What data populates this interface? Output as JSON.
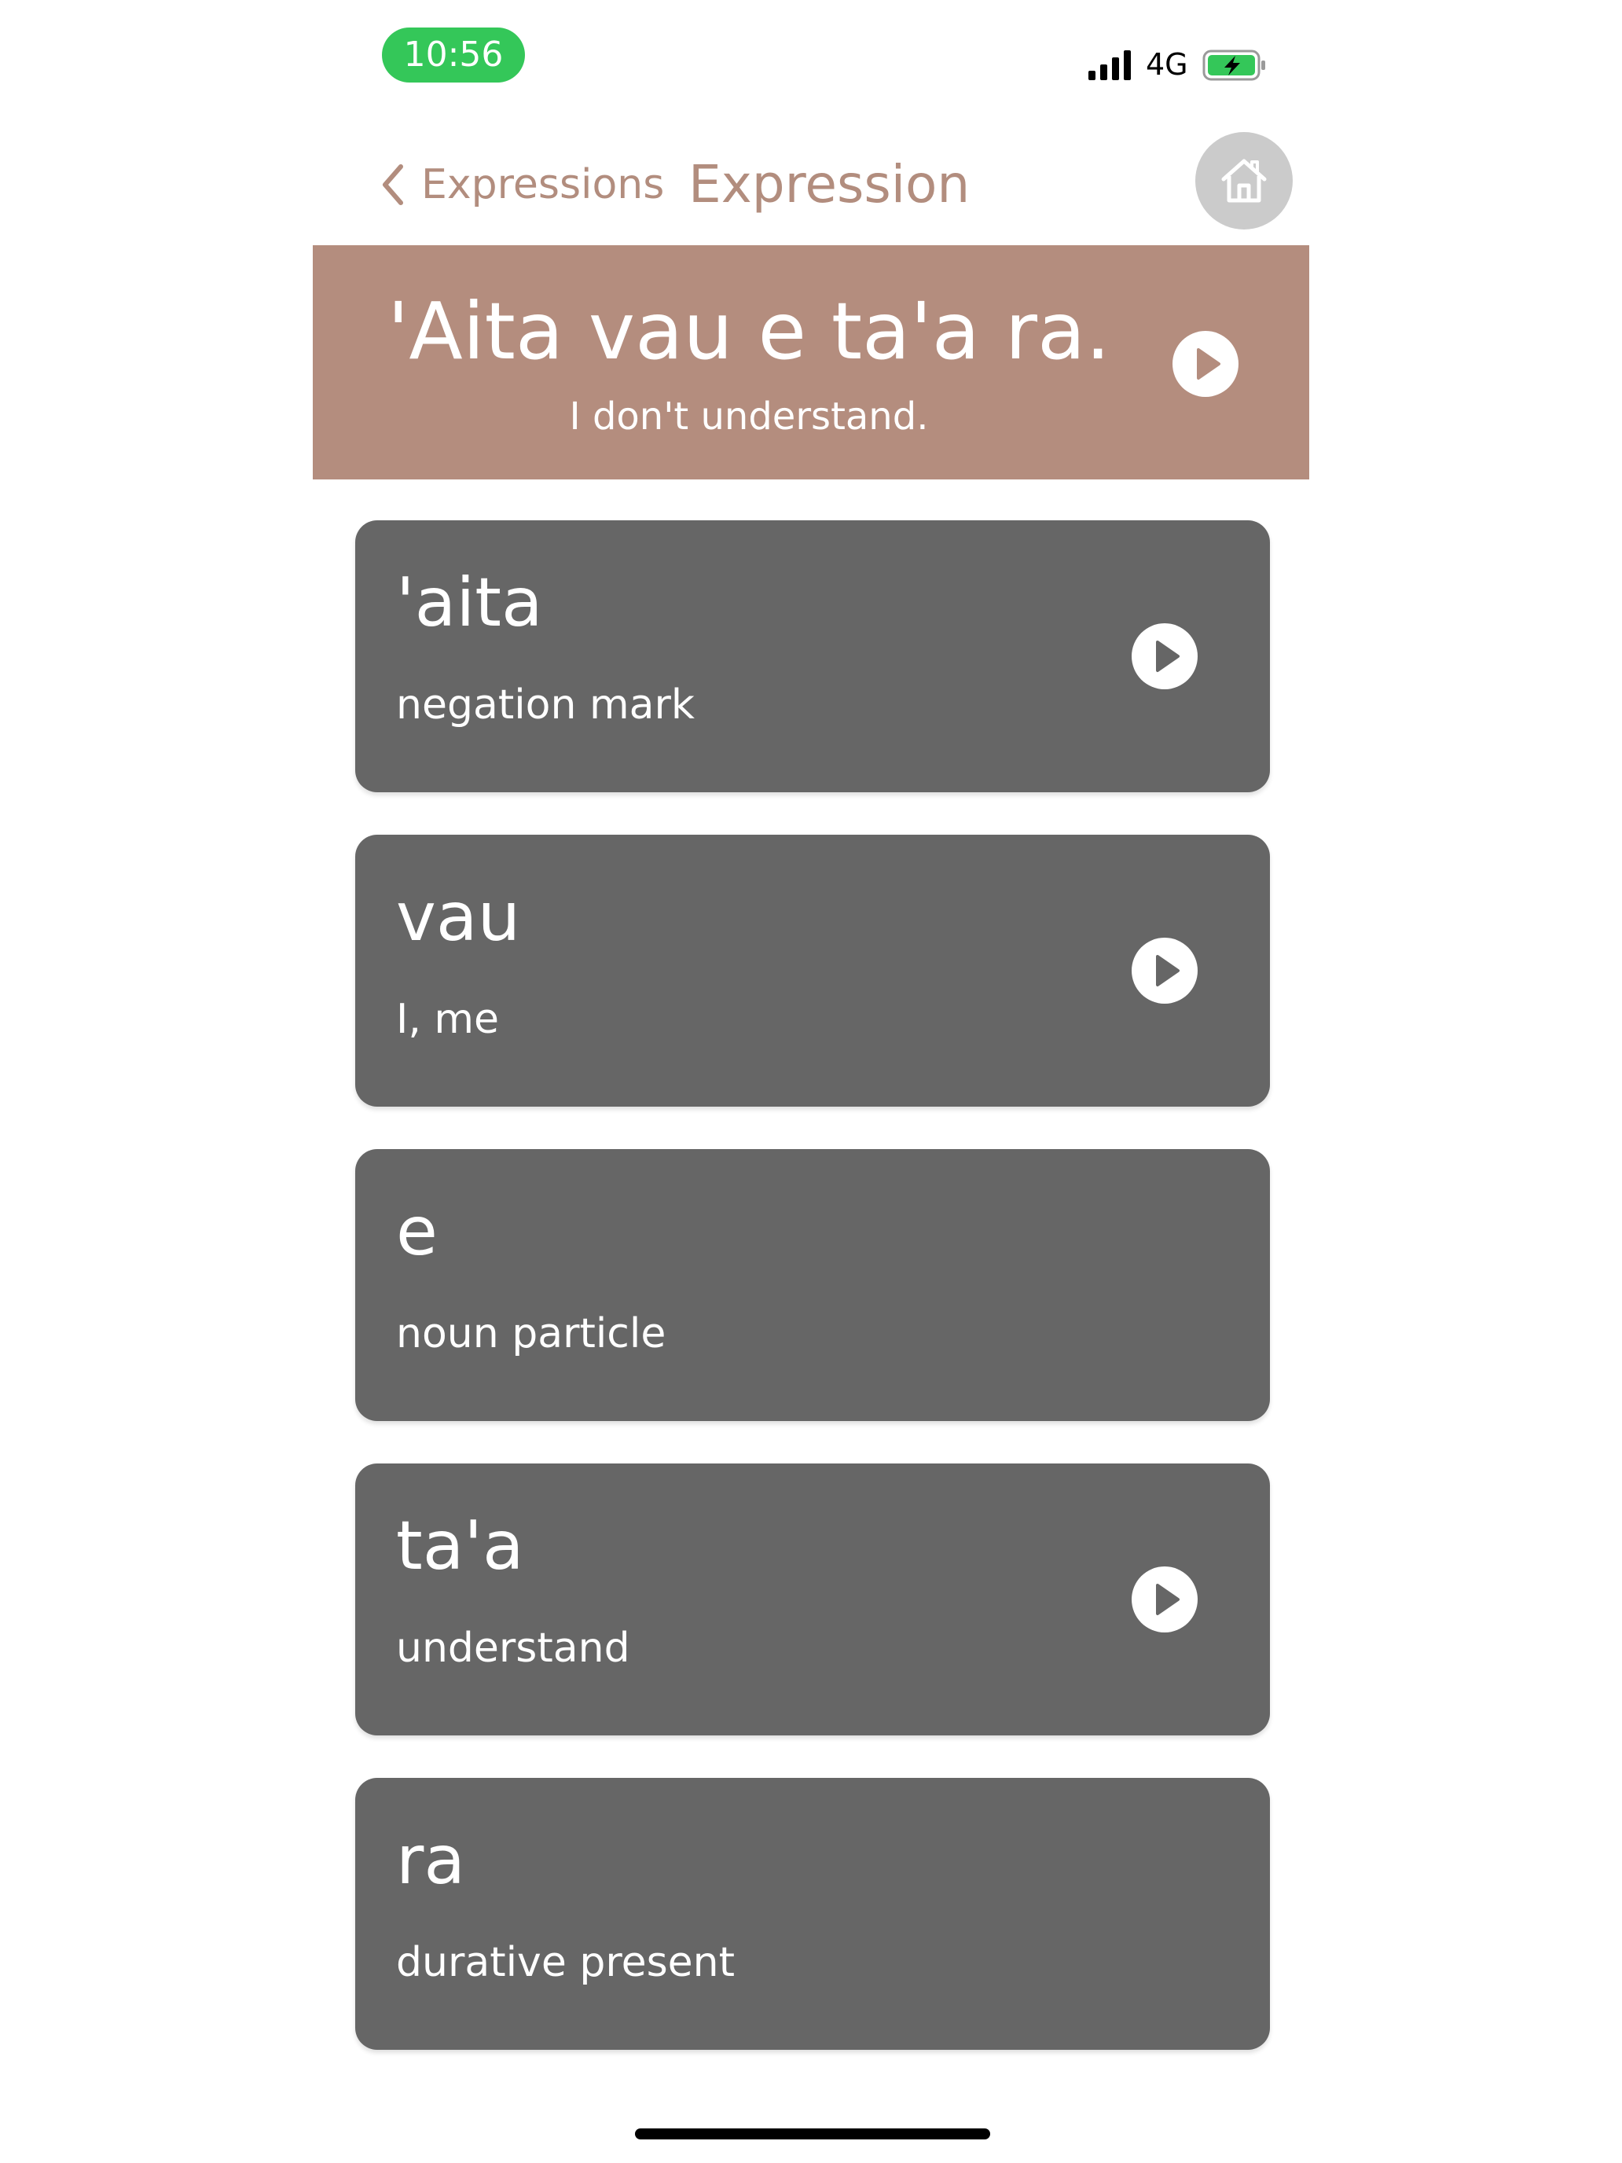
{
  "status_bar": {
    "time": "10:56",
    "network": "4G",
    "signal_icon": "cellular-signal-icon",
    "battery_icon": "battery-charging-icon",
    "time_pill_color": "#34c759"
  },
  "nav": {
    "back_label": "Expressions",
    "title": "Expression",
    "back_icon": "chevron-left-icon",
    "home_icon": "home-icon",
    "accent_color": "#b28d7e"
  },
  "expression": {
    "phrase": "'Aita vau e ta'a ra.",
    "translation": "I don't understand.",
    "play_icon": "play-circle-icon",
    "banner_color": "#b48d7e"
  },
  "words": [
    {
      "word": "'aita",
      "meaning": "negation mark",
      "has_audio": true
    },
    {
      "word": "vau",
      "meaning": "I, me",
      "has_audio": true
    },
    {
      "word": "e",
      "meaning": "noun particle",
      "has_audio": false
    },
    {
      "word": "ta'a",
      "meaning": "understand",
      "has_audio": true
    },
    {
      "word": "ra",
      "meaning": "durative present",
      "has_audio": false
    }
  ],
  "card_color": "#666666"
}
